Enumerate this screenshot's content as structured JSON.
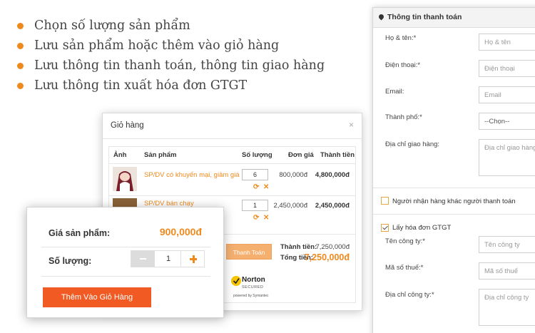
{
  "bullets": [
    "Chọn số lượng sản phẩm",
    "Lưu sản phẩm hoặc thêm vào giỏ hàng",
    "Lưu thông tin thanh toán, thông tin giao hàng",
    "Lưu thông tin xuất hóa đơn GTGT"
  ],
  "payment_form": {
    "title": "Thông tin thanh toán",
    "fields": [
      {
        "label": "Họ & tên:*",
        "placeholder": "Họ & tên"
      },
      {
        "label": "Điện thoại:*",
        "placeholder": "Điện thoại"
      },
      {
        "label": "Email:",
        "placeholder": "Email"
      },
      {
        "label": "Thành phố:*",
        "value": "--Chọn--"
      },
      {
        "label": "Địa chỉ giao hàng:",
        "placeholder": "Địa chỉ giao hàng"
      }
    ],
    "other_receiver_label": "Người nhận hàng khác người thanh toán",
    "other_receiver_checked": false,
    "invoice_label": "Lấy hóa đơn GTGT",
    "invoice_checked": true,
    "invoice_fields": [
      {
        "label": "Tên công ty:*",
        "placeholder": "Tên công ty"
      },
      {
        "label": "Mã số thuế:*",
        "placeholder": "Mã số thuế"
      },
      {
        "label": "Địa chỉ công ty:*",
        "placeholder": "Địa chỉ công ty"
      }
    ]
  },
  "cart": {
    "title": "Giỏ hàng",
    "close_icon": "close-icon",
    "columns": [
      "Ảnh",
      "Sản phẩm",
      "Số lượng",
      "Đơn giá",
      "Thành tiền"
    ],
    "rows": [
      {
        "name": "SP/DV có khuyến mại, giảm giá",
        "qty": "6",
        "unit_price": "800,000đ",
        "total": "4,800,000đ"
      },
      {
        "name": "SP/DV bán chạy",
        "qty": "1",
        "unit_price": "2,450,000đ",
        "total": "2,450,000đ"
      }
    ],
    "pay_button": "Thanh Toán",
    "subtotal_label": "Thành tiền:",
    "subtotal_value": "7,250,000đ",
    "grand_label": "Tổng tiền:",
    "grand_value": "7,250,000đ",
    "norton": {
      "brand": "Norton",
      "sub": "SECURED",
      "by": "powered by Symantec"
    },
    "accent_color": "#f0891c"
  },
  "product_card": {
    "price_label": "Giá sản phẩm:",
    "price_value": "900,000đ",
    "qty_label": "Số lượng:",
    "qty_value": "1",
    "add_button": "Thêm Vào Giỏ Hàng",
    "button_color": "#f15a22"
  }
}
